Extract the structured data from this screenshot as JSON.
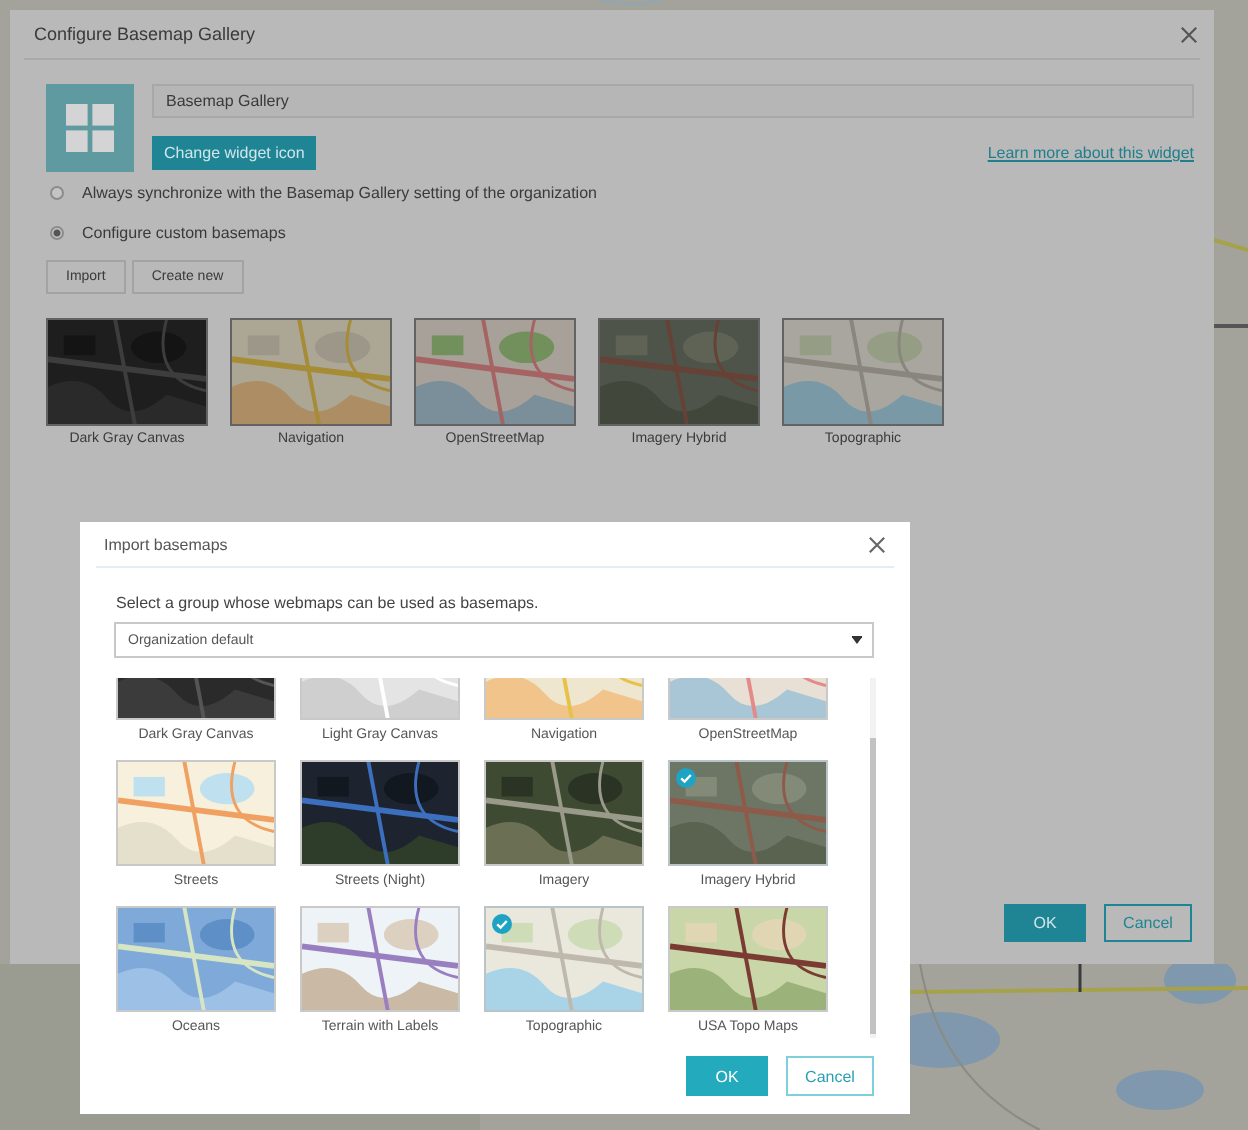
{
  "configure_dialog": {
    "title": "Configure Basemap Gallery",
    "widget_name": "Basemap Gallery",
    "change_icon_button": "Change widget icon",
    "learn_more_link": "Learn more about this widget",
    "options": [
      {
        "label": "Always synchronize with the Basemap Gallery setting of the organization",
        "selected": false
      },
      {
        "label": "Configure custom basemaps",
        "selected": true
      }
    ],
    "buttons": [
      "Import",
      "Create new"
    ],
    "basemaps": [
      {
        "label": "Dark Gray Canvas"
      },
      {
        "label": "Navigation"
      },
      {
        "label": "OpenStreetMap"
      },
      {
        "label": "Imagery Hybrid"
      },
      {
        "label": "Topographic"
      }
    ],
    "ok_button": "OK",
    "cancel_button": "Cancel"
  },
  "import_dialog": {
    "title": "Import basemaps",
    "prompt": "Select a group whose webmaps can be used as basemaps.",
    "group_select": {
      "value": "Organization default"
    },
    "basemaps": [
      {
        "label": "Dark Gray Canvas",
        "selected": false
      },
      {
        "label": "Light Gray Canvas",
        "selected": false
      },
      {
        "label": "Navigation",
        "selected": false
      },
      {
        "label": "OpenStreetMap",
        "selected": false
      },
      {
        "label": "Streets",
        "selected": false
      },
      {
        "label": "Streets (Night)",
        "selected": false
      },
      {
        "label": "Imagery",
        "selected": false
      },
      {
        "label": "Imagery Hybrid",
        "selected": true
      },
      {
        "label": "Oceans",
        "selected": false
      },
      {
        "label": "Terrain with Labels",
        "selected": false
      },
      {
        "label": "Topographic",
        "selected": true
      },
      {
        "label": "USA Topo Maps",
        "selected": false
      }
    ],
    "ok_button": "OK",
    "cancel_button": "Cancel"
  }
}
